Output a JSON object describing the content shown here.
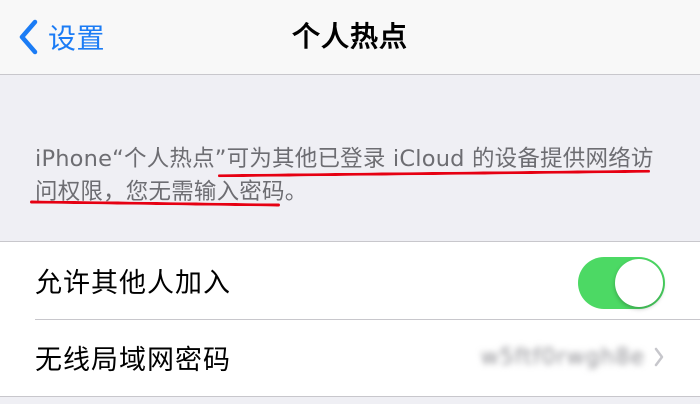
{
  "navbar": {
    "back_label": "设置",
    "title": "个人热点"
  },
  "description": {
    "text": "iPhone“个人热点”可为其他已登录 iCloud 的设备提供网络访问权限，您无需输入密码。"
  },
  "settings": {
    "allow_others": {
      "label": "允许其他人加入",
      "enabled": true
    },
    "wifi_password": {
      "label": "无线局域网密码",
      "value": "w5ftf0rwgh8e"
    }
  },
  "colors": {
    "accent": "#1b7cf5",
    "toggle_on": "#4cd964",
    "annotation": "#e60012"
  }
}
